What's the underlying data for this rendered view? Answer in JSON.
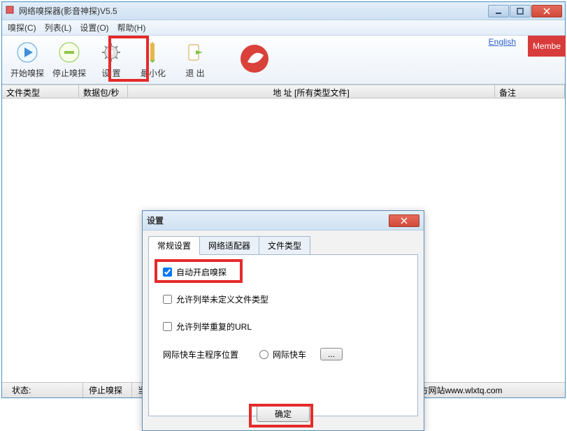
{
  "window": {
    "title": "网络嗅探器(影音神探)V5.5"
  },
  "menubar": {
    "items": [
      {
        "label": "嗅探(C)"
      },
      {
        "label": "列表(L)"
      },
      {
        "label": "设置(O)"
      },
      {
        "label": "帮助(H)"
      }
    ]
  },
  "toolbar": {
    "items": [
      {
        "label": "开始嗅探"
      },
      {
        "label": "停止嗅探"
      },
      {
        "label": "设 置"
      },
      {
        "label": "最小化"
      },
      {
        "label": "退 出"
      }
    ],
    "link_english": "English",
    "member": "Membe"
  },
  "columns": {
    "filetype": "文件类型",
    "packets": "数据包/秒",
    "address": "地 址  [所有类型文件]",
    "note": "备注"
  },
  "status": {
    "label": "状态:",
    "text": "停止嗅探",
    "mode": "当前工作模式[获取URL]",
    "site": "网络嗅探器(影音神探)官方网站www.wlxtq.com"
  },
  "dialog": {
    "title": "设置",
    "tabs": [
      {
        "label": "常规设置"
      },
      {
        "label": "网络适配器"
      },
      {
        "label": "文件类型"
      }
    ],
    "auto_start": "自动开启嗅探",
    "allow_undefined": "允许列举未定义文件类型",
    "allow_duplicate_url": "允许列举重复的URL",
    "flashget_label": "网际快车主程序位置",
    "flashget_radio": "网际快车",
    "browse": "...",
    "ok": "确定"
  }
}
